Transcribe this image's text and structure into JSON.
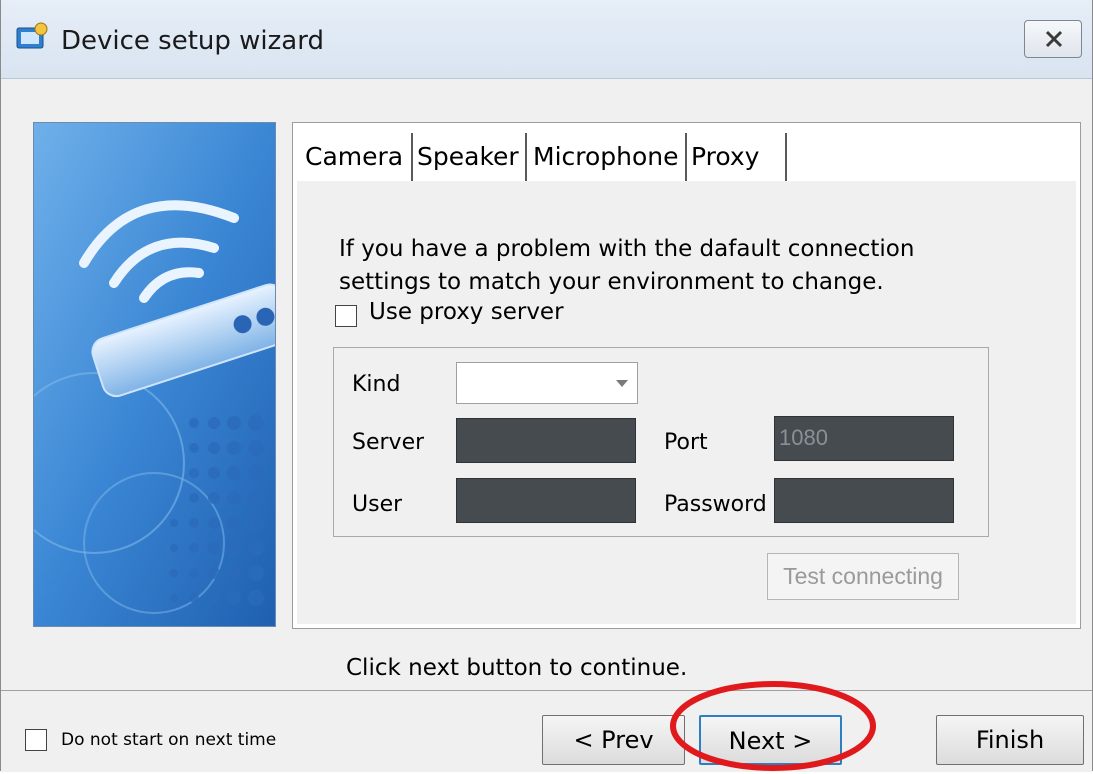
{
  "window": {
    "title": "Device setup wizard",
    "close_icon": "close-icon"
  },
  "tabs": [
    {
      "label": "Camera"
    },
    {
      "label": "Speaker"
    },
    {
      "label": "Microphone"
    },
    {
      "label": "Proxy",
      "active": true
    }
  ],
  "proxy": {
    "description_line1": "If you have a problem with the dafault connection",
    "description_line2": "settings to match your environment to change.",
    "use_proxy_label": "Use proxy server",
    "use_proxy_checked": false,
    "kind_label": "Kind",
    "kind_value": "",
    "server_label": "Server",
    "server_value": "",
    "port_label": "Port",
    "port_value": "1080",
    "user_label": "User",
    "user_value": "",
    "password_label": "Password",
    "password_value": "",
    "test_button": "Test connecting"
  },
  "hint": "Click next button to continue.",
  "footer": {
    "dont_start_label": "Do not start on next time",
    "dont_start_checked": false,
    "prev_button": "< Prev",
    "next_button": "Next >",
    "finish_button": "Finish"
  },
  "colors": {
    "annotation_circle": "#e0191d",
    "input_dark": "#454b4f",
    "banner_blue": "#3a86d4"
  }
}
